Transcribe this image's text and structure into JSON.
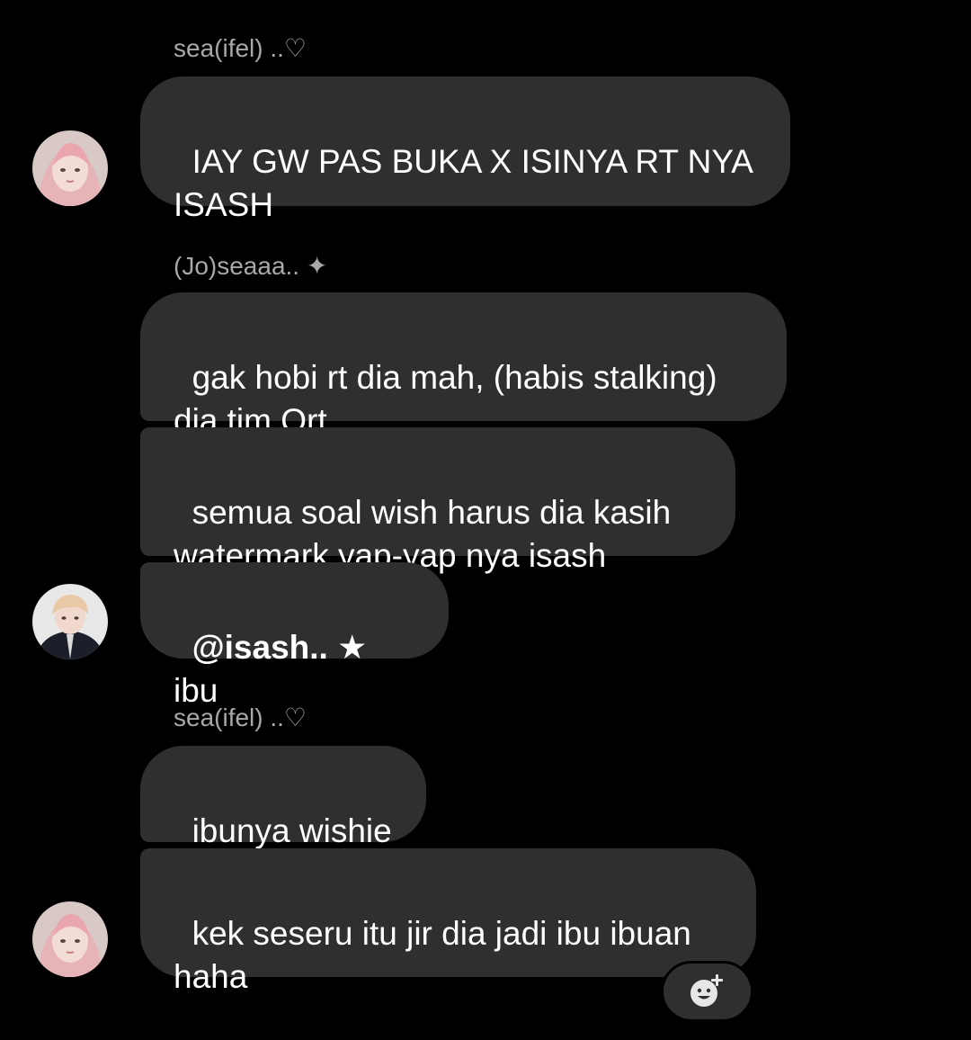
{
  "messages": {
    "group1": {
      "sender": "sea(ifel) ..♡",
      "bubble1": "IAY GW PAS BUKA X ISINYA RT NYA ISASH"
    },
    "group2": {
      "sender": "(Jo)seaaa.. ✦",
      "bubble1": "gak hobi rt dia mah, (habis stalking) dia tim Qrt",
      "bubble2": "semua soal wish harus dia kasih watermark yap-yap nya isash",
      "bubble3_mention": "@isash.. ★",
      "bubble3_text": " ibu"
    },
    "group3": {
      "sender": "sea(ifel) ..♡",
      "bubble1": "ibunya wishie",
      "bubble2": "kek seseru itu jir dia jadi ibu ibuan haha"
    }
  },
  "icons": {
    "reaction": "add-reaction-icon"
  },
  "colors": {
    "background": "#000000",
    "bubble": "#2f2f2f",
    "sender_name": "#a8a8a8",
    "text": "#ffffff"
  }
}
